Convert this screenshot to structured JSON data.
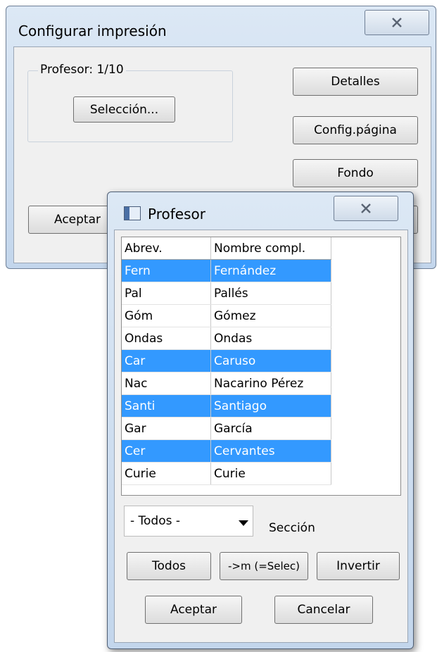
{
  "config_dialog": {
    "title": "Configurar impresión",
    "group_label": "Profesor: 1/10",
    "seleccion_button": "Selección...",
    "detalles_button": "Detalles",
    "config_pagina_button": "Config.página",
    "fondo_button": "Fondo",
    "aceptar_button": "Aceptar"
  },
  "profesor_dialog": {
    "title": "Profesor",
    "columns": [
      "Abrev.",
      "Nombre compl."
    ],
    "rows": [
      {
        "abrev": "Fern",
        "nombre": "Fernández",
        "selected": true
      },
      {
        "abrev": "Pal",
        "nombre": "Pallés",
        "selected": false
      },
      {
        "abrev": "Góm",
        "nombre": "Gómez",
        "selected": false
      },
      {
        "abrev": "Ondas",
        "nombre": "Ondas",
        "selected": false
      },
      {
        "abrev": "Car",
        "nombre": "Caruso",
        "selected": true
      },
      {
        "abrev": "Nac",
        "nombre": "Nacarino Pérez",
        "selected": false
      },
      {
        "abrev": "Santi",
        "nombre": "Santiago",
        "selected": true
      },
      {
        "abrev": "Gar",
        "nombre": "García",
        "selected": false
      },
      {
        "abrev": "Cer",
        "nombre": "Cervantes",
        "selected": true
      },
      {
        "abrev": "Curie",
        "nombre": "Curie",
        "selected": false
      }
    ],
    "dropdown_value": "- Todos -",
    "seccion_label": "Sección",
    "todos_button": "Todos",
    "selec_button": "->m (=Selec)",
    "invertir_button": "Invertir",
    "aceptar_button": "Aceptar",
    "cancelar_button": "Cancelar"
  },
  "icons": {
    "close": "close-icon",
    "window": "window-icon",
    "dropdown": "chevron-down-icon"
  },
  "colors": {
    "selection": "#3399ff",
    "frame": "#c9daee"
  }
}
